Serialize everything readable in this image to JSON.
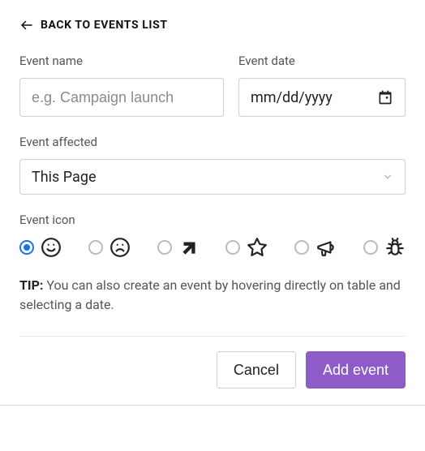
{
  "back": {
    "label": "BACK TO EVENTS LIST"
  },
  "fields": {
    "name": {
      "label": "Event name",
      "placeholder": "e.g. Campaign launch",
      "value": ""
    },
    "date": {
      "label": "Event date",
      "display": "mm/dd/yyyy",
      "value": ""
    },
    "affected": {
      "label": "Event affected",
      "selected": "This Page"
    },
    "icon": {
      "label": "Event icon",
      "selected": "smile"
    }
  },
  "icons": [
    "smile",
    "frown",
    "arrow",
    "star",
    "megaphone",
    "bug"
  ],
  "tip": {
    "prefix": "TIP:",
    "text": "You can also create an event by hovering directly on table and selecting a date."
  },
  "actions": {
    "cancel": "Cancel",
    "submit": "Add event"
  },
  "colors": {
    "primary": "#8e5cc9",
    "accentRadio": "#1a73e8"
  }
}
